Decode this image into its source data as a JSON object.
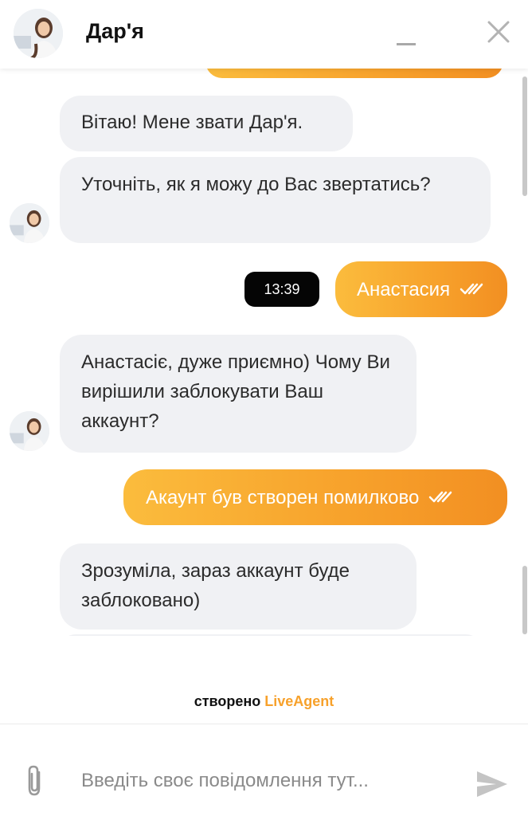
{
  "header": {
    "agent_name": "Дар'я",
    "avatar_icon": "agent-avatar",
    "minimize_icon": "minimize-icon",
    "close_icon": "close-icon"
  },
  "messages": [
    {
      "from": "agent",
      "text": "Вітаю! Мене звати Дар'я."
    },
    {
      "from": "agent",
      "text": "Уточніть, як  я можу до Вас звертатись?"
    },
    {
      "from": "visitor",
      "text": "Анастасия",
      "time": "13:39",
      "status": "read"
    },
    {
      "from": "agent",
      "text": "Анастасіє, дуже приємно) Чому Ви вирішили заблокувати Ваш аккаунт?"
    },
    {
      "from": "visitor",
      "text": "Акаунт був створен помилково",
      "status": "read"
    },
    {
      "from": "agent",
      "text": "Зрозуміла, зараз аккаунт буде заблоковано)"
    }
  ],
  "footer": {
    "powered_prefix": "створено",
    "powered_brand": "LiveAgent"
  },
  "composer": {
    "placeholder": "Введіть своє повідомлення тут...",
    "value": "",
    "attach_icon": "paperclip-icon",
    "send_icon": "send-icon"
  },
  "colors": {
    "accent": "#f7a12b",
    "incoming_bubble": "#f0f1f4",
    "time_badge": "#050505"
  }
}
